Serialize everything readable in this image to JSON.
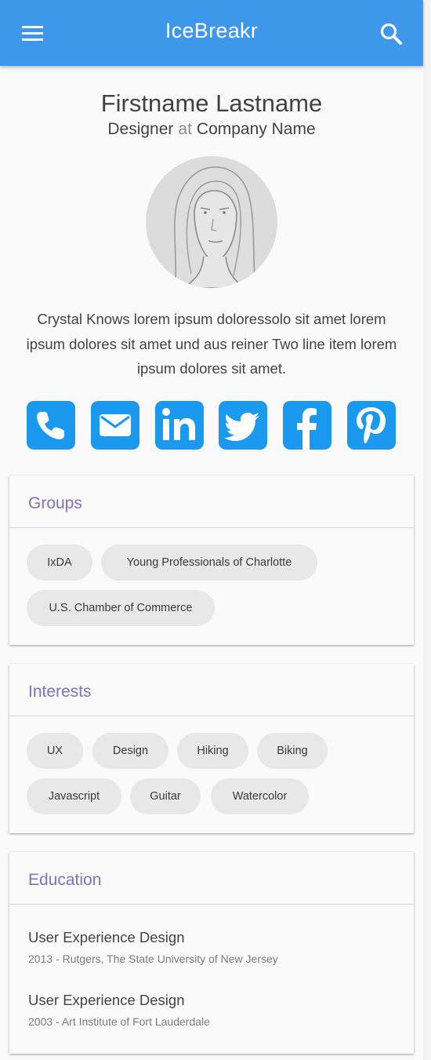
{
  "app_bar": {
    "title": "IceBreakr",
    "menu_icon": "hamburger-menu-icon",
    "search_icon": "search-icon",
    "color": "#3d98ec"
  },
  "profile": {
    "name": "Firstname Lastname",
    "role": "Designer",
    "at": "at",
    "company": "Company Name",
    "bio": "Crystal Knows lorem ipsum doloressolo sit amet lorem ipsum dolores sit amet und aus reiner Two line item lorem ipsum dolores sit amet."
  },
  "social": {
    "color": "#1b99ef",
    "icons": [
      "phone-icon",
      "email-icon",
      "linkedin-icon",
      "twitter-icon",
      "facebook-icon",
      "pinterest-icon"
    ]
  },
  "groups": {
    "title": "Groups",
    "chips": [
      "IxDA",
      "Young Professionals of Charlotte",
      "U.S. Chamber of Commerce"
    ]
  },
  "interests": {
    "title": "Interests",
    "chips": [
      "UX",
      "Design",
      "Hiking",
      "Biking",
      "Javascript",
      "Guitar",
      "Watercolor"
    ]
  },
  "education": {
    "title": "Education",
    "items": [
      {
        "title": "User Experience Design",
        "detail": "2013 - Rutgers, The State University of New Jersey"
      },
      {
        "title": "User Experience Design",
        "detail": "2003 - Art Institute of Fort Lauderdale"
      }
    ]
  }
}
